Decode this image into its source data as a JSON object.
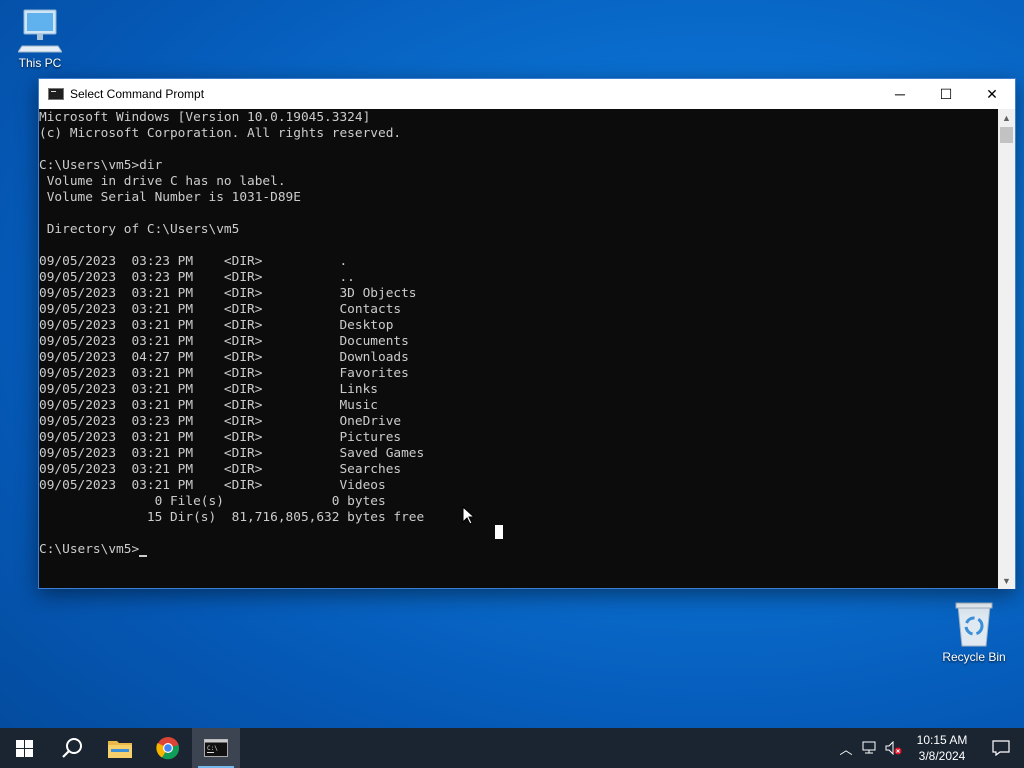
{
  "desktop": {
    "icons": [
      {
        "label": "This PC"
      },
      {
        "label": "Recycle Bin"
      }
    ]
  },
  "window": {
    "title": "Select Command Prompt",
    "buttons": {
      "minimize": "─",
      "maximize": "☐",
      "close": "✕"
    },
    "console_lines": [
      "Microsoft Windows [Version 10.0.19045.3324]",
      "(c) Microsoft Corporation. All rights reserved.",
      "",
      "C:\\Users\\vm5>dir",
      " Volume in drive C has no label.",
      " Volume Serial Number is 1031-D89E",
      "",
      " Directory of C:\\Users\\vm5",
      "",
      "09/05/2023  03:23 PM    <DIR>          .",
      "09/05/2023  03:23 PM    <DIR>          ..",
      "09/05/2023  03:21 PM    <DIR>          3D Objects",
      "09/05/2023  03:21 PM    <DIR>          Contacts",
      "09/05/2023  03:21 PM    <DIR>          Desktop",
      "09/05/2023  03:21 PM    <DIR>          Documents",
      "09/05/2023  04:27 PM    <DIR>          Downloads",
      "09/05/2023  03:21 PM    <DIR>          Favorites",
      "09/05/2023  03:21 PM    <DIR>          Links",
      "09/05/2023  03:21 PM    <DIR>          Music",
      "09/05/2023  03:23 PM    <DIR>          OneDrive",
      "09/05/2023  03:21 PM    <DIR>          Pictures",
      "09/05/2023  03:21 PM    <DIR>          Saved Games",
      "09/05/2023  03:21 PM    <DIR>          Searches",
      "09/05/2023  03:21 PM    <DIR>          Videos",
      "               0 File(s)              0 bytes",
      "              15 Dir(s)  81,716,805,632 bytes free",
      ""
    ],
    "prompt": "C:\\Users\\vm5>"
  },
  "taskbar": {
    "items": [
      "start-icon",
      "search-icon",
      "file-explorer-icon",
      "chrome-icon",
      "command-prompt-icon"
    ],
    "clock": {
      "time": "10:15 AM",
      "date": "3/8/2024"
    }
  },
  "colors": {
    "console_bg": "#0c0c0c",
    "console_fg": "#cccccc",
    "taskbar_bg": "#1b2531",
    "accent": "#76b9ed"
  }
}
